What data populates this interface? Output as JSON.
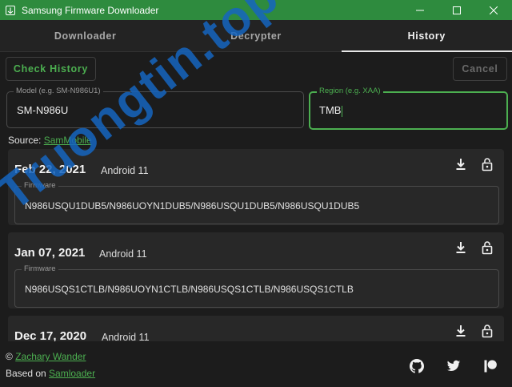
{
  "window": {
    "title": "Samsung Firmware Downloader"
  },
  "tabs": [
    {
      "label": "Downloader"
    },
    {
      "label": "Decrypter"
    },
    {
      "label": "History"
    }
  ],
  "toolbar": {
    "check_label": "Check History",
    "cancel_label": "Cancel"
  },
  "model_field": {
    "label": "Model (e.g. SM-N986U1)",
    "value": "SM-N986U"
  },
  "region_field": {
    "label": "Region (e.g. XAA)",
    "value": "TMB"
  },
  "source": {
    "prefix": "Source: ",
    "link": "SamMobile"
  },
  "history": [
    {
      "date": "Feb 22, 2021",
      "android": "Android 11",
      "firmware_label": "Firmware",
      "firmware": "N986USQU1DUB5/N986UOYN1DUB5/N986USQU1DUB5/N986USQU1DUB5"
    },
    {
      "date": "Jan 07, 2021",
      "android": "Android 11",
      "firmware_label": "Firmware",
      "firmware": "N986USQS1CTLB/N986UOYN1CTLB/N986USQS1CTLB/N986USQS1CTLB"
    },
    {
      "date": "Dec 17, 2020",
      "android": "Android 11"
    }
  ],
  "footer": {
    "copyright_prefix": "© ",
    "author": "Zachary Wander",
    "based_prefix": "Based on ",
    "based_link": "Samloader"
  },
  "watermark": {
    "text": "Truongtin.top"
  },
  "colors": {
    "titlebar": "#2e8b3e",
    "accent": "#4caf50",
    "background": "#1c1c1c",
    "card": "#282828",
    "watermark": "#1565c0",
    "watermark_accent": "#e53935"
  }
}
